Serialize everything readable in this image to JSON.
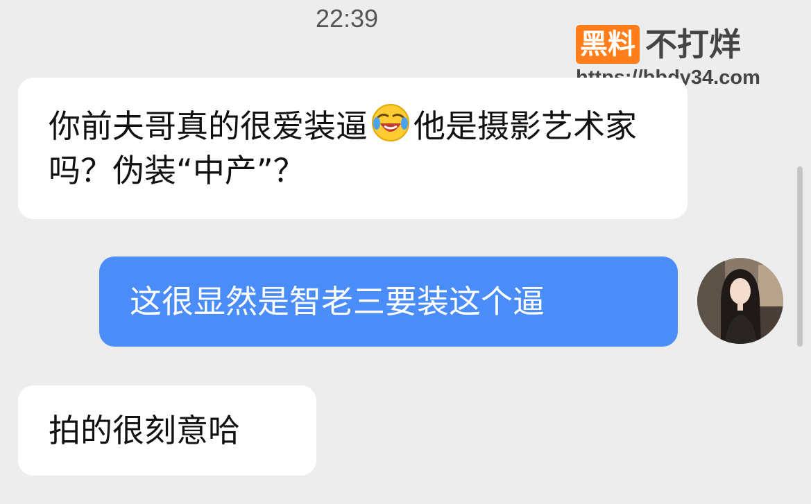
{
  "header": {
    "time": "22:39"
  },
  "watermark": {
    "badge": "黑料",
    "title": "不打烊",
    "url": "https://bbdy34.com",
    "accent_color": "#ff7d1a"
  },
  "messages": [
    {
      "direction": "incoming",
      "text_part1": "你前夫哥真的很爱装逼",
      "emoji_icon": "laughing-crying-emoji",
      "text_part2": "他是摄影艺术家吗？伪装“中产”？"
    },
    {
      "direction": "outgoing",
      "text": "这很显然是智老三要装这个逼",
      "bubble_color": "#4a8df8"
    },
    {
      "direction": "incoming",
      "text": "拍的很刻意哈"
    }
  ],
  "avatar": {
    "icon": "user-avatar"
  }
}
